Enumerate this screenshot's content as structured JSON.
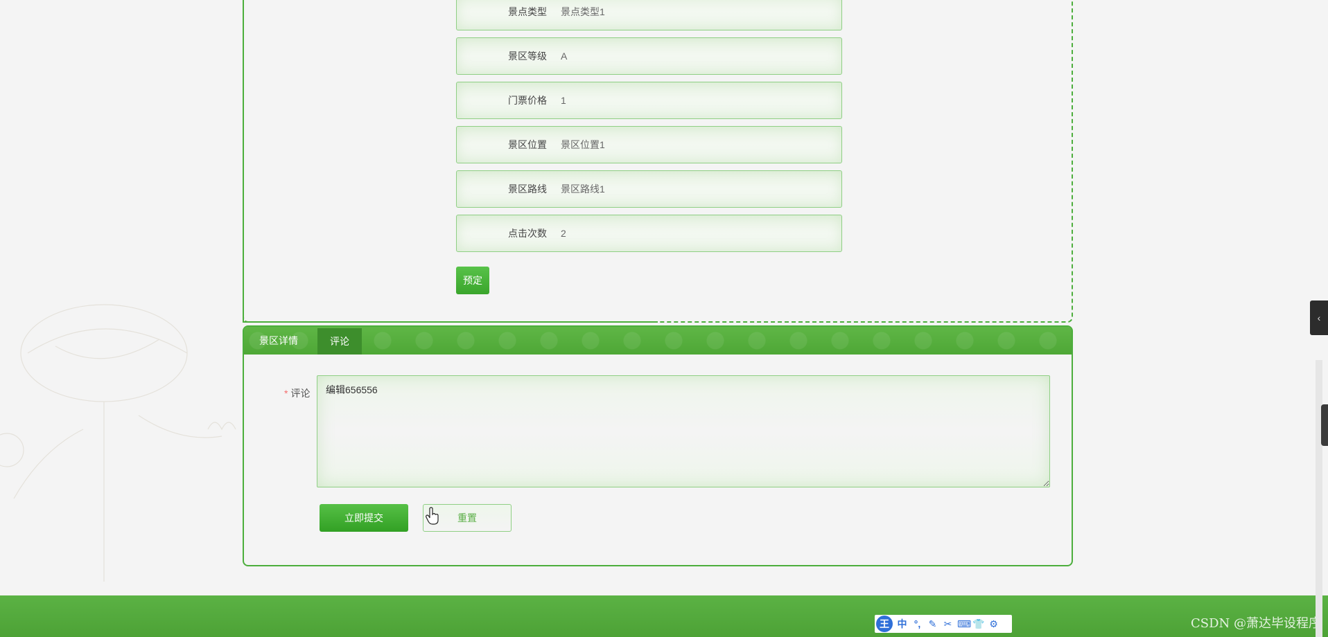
{
  "details": {
    "fields": [
      {
        "label": "景点类型",
        "value": "景点类型1"
      },
      {
        "label": "景区等级",
        "value": "A"
      },
      {
        "label": "门票价格",
        "value": "1"
      },
      {
        "label": "景区位置",
        "value": "景区位置1"
      },
      {
        "label": "景区路线",
        "value": "景区路线1"
      },
      {
        "label": "点击次数",
        "value": "2"
      }
    ],
    "book_label": "预定"
  },
  "tabs": [
    {
      "label": "景区详情",
      "active": false
    },
    {
      "label": "评论",
      "active": true
    }
  ],
  "comment_form": {
    "required_mark": "*",
    "label": "评论",
    "value": "编辑656556",
    "submit_label": "立即提交",
    "reset_label": "重置"
  },
  "ime_toolbar": {
    "logo": "王",
    "items": [
      "中",
      "°,",
      "✎",
      "✂",
      "⌨",
      "👕",
      "⚙"
    ]
  },
  "watermark": "CSDN @萧达毕设程序",
  "colors": {
    "accent": "#4cae3c",
    "tab_bar": "#5aaf42",
    "active_tab": "#3d8e2c",
    "required": "#f56c6c"
  }
}
